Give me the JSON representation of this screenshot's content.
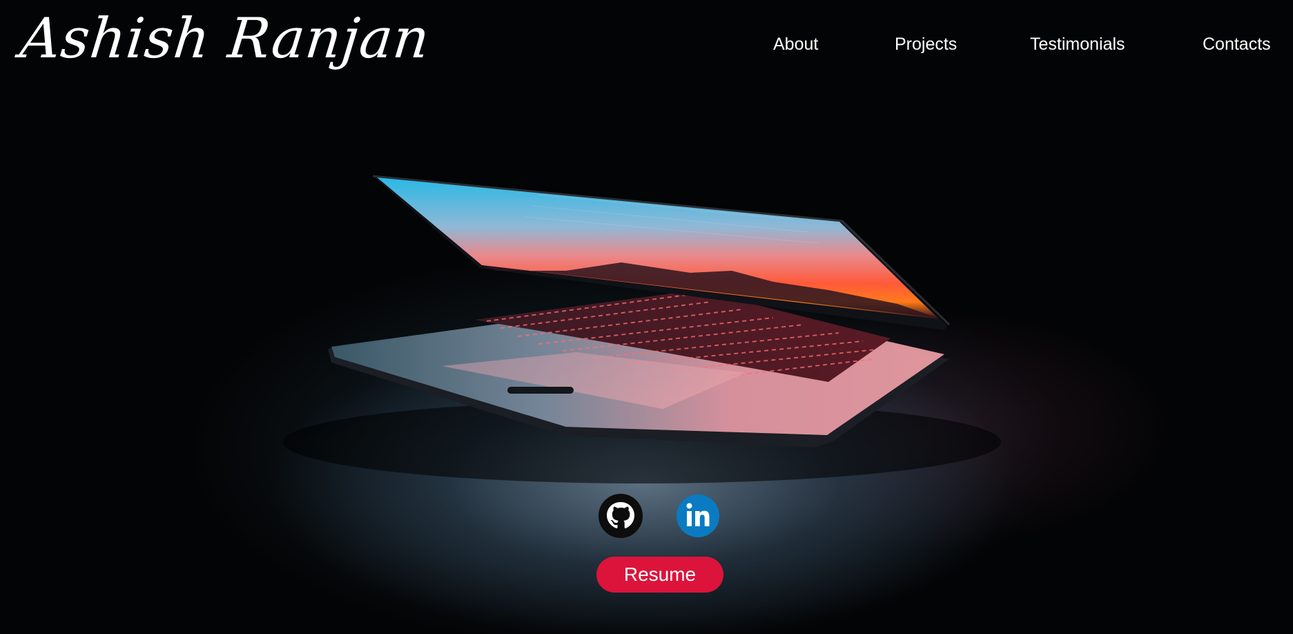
{
  "header": {
    "brand_name": "Ashish Ranjan",
    "nav": {
      "about": "About",
      "projects": "Projects",
      "testimonials": "Testimonials",
      "contacts": "Contacts"
    }
  },
  "hero": {
    "image_icon": "laptop-image",
    "social": [
      {
        "name": "github",
        "icon": "github-icon"
      },
      {
        "name": "linkedin",
        "icon": "linkedin-icon"
      }
    ],
    "resume_label": "Resume"
  },
  "colors": {
    "background": "#000000",
    "text": "#ffffff",
    "resume_button": "#dc143c",
    "linkedin": "#0a7bc2"
  }
}
